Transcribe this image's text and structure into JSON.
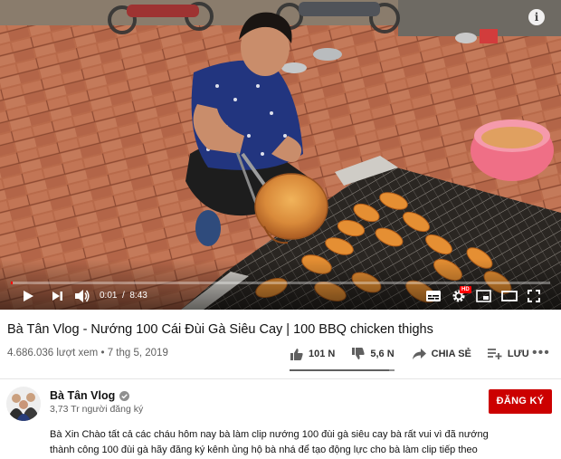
{
  "player": {
    "time_current": "0:01",
    "time_total": "8:43",
    "progress_fraction": 0.002,
    "hd_badge": "HD",
    "colors": {
      "progress": "#ff0000",
      "bar_bg": "rgba(255,255,255,0.35)"
    },
    "icons": [
      "play-icon",
      "next-icon",
      "volume-icon",
      "subtitles-icon",
      "settings-icon",
      "miniplayer-icon",
      "theater-icon",
      "fullscreen-icon",
      "info-icon"
    ]
  },
  "video": {
    "title": "Bà Tân Vlog - Nướng 100 Cái Đùi Gà Siêu Cay | 100 BBQ chicken thighs",
    "views": "4.686.036 lượt xem",
    "separator": "•",
    "date": "7 thg 5, 2019"
  },
  "actions": {
    "likes": "101 N",
    "dislikes": "5,6 N",
    "share_label": "CHIA SẺ",
    "save_label": "LƯU",
    "more_label": "•••",
    "like_ratio": 0.95
  },
  "channel": {
    "name": "Bà Tân Vlog",
    "subscribers": "3,73 Tr người đăng ký",
    "subscribe_label": "ĐĂNG KÝ",
    "subscribe_color": "#cc0000"
  },
  "description": {
    "line1": "Bà Xin Chào tất cả các cháu hôm nay bà làm clip nướng 100 đùi gà siêu cay bà rất vui vì đã nướng",
    "line2": "thành công 100 đùi gà hãy đăng ký kênh ủng hộ bà nhá để tạo động lực cho bà làm clip tiếp theo"
  }
}
